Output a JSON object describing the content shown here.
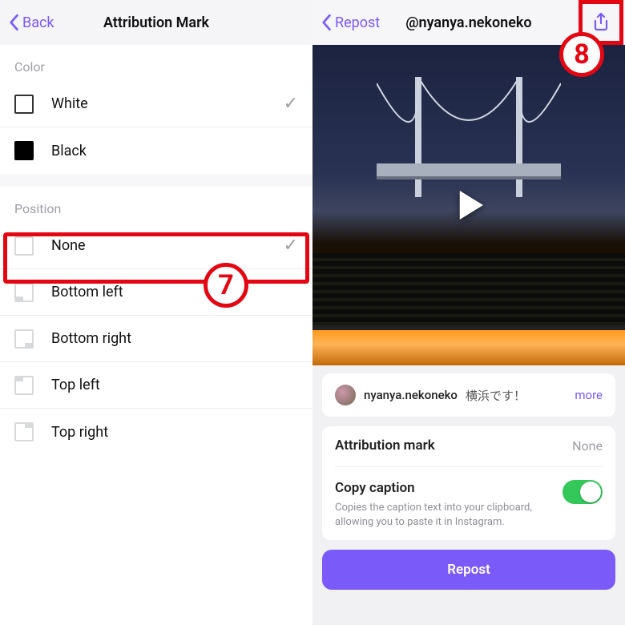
{
  "left": {
    "back": "Back",
    "title": "Attribution Mark",
    "section_color": "Color",
    "section_position": "Position",
    "colors": [
      {
        "label": "White",
        "checked": true
      },
      {
        "label": "Black",
        "checked": false
      }
    ],
    "positions": [
      {
        "label": "None",
        "checked": true
      },
      {
        "label": "Bottom left",
        "checked": false
      },
      {
        "label": "Bottom right",
        "checked": false
      },
      {
        "label": "Top left",
        "checked": false
      },
      {
        "label": "Top right",
        "checked": false
      }
    ]
  },
  "right": {
    "back": "Repost",
    "username": "@nyanya.nekoneko",
    "caption_user": "nyanya.nekoneko",
    "caption_text": "横浜です！",
    "more": "more",
    "attribution_label": "Attribution mark",
    "attribution_value": "None",
    "copy_label": "Copy caption",
    "copy_desc": "Copies the caption text into your clipboard, allowing you to paste it in Instagram.",
    "repost_button": "Repost"
  },
  "annotations": {
    "n7": "7",
    "n8": "8"
  }
}
